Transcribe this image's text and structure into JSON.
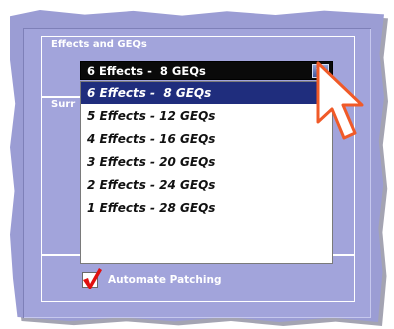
{
  "effects_group": {
    "label": "Effects and GEQs",
    "select": {
      "value": "6 Effects -  8 GEQs",
      "options": [
        "6 Effects -  8 GEQs",
        "5 Effects - 12 GEQs",
        "4 Effects - 16 GEQs",
        "3 Effects - 20 GEQs",
        "2 Effects - 24 GEQs",
        "1 Effects - 28 GEQs"
      ],
      "highlighted_index": 0
    }
  },
  "surround_group": {
    "label": "Surr"
  },
  "automate_patching": {
    "label": "Automate Patching",
    "checked": true
  },
  "colors": {
    "panel": "#9b9dd4",
    "highlight": "#1f2d7d",
    "check_mark": "#e01010",
    "cursor_outline": "#f05a28"
  },
  "icons": {
    "dropdown_arrow": "chevron-down-icon",
    "checkmark": "checkmark-icon",
    "cursor": "pointer-cursor-icon"
  }
}
